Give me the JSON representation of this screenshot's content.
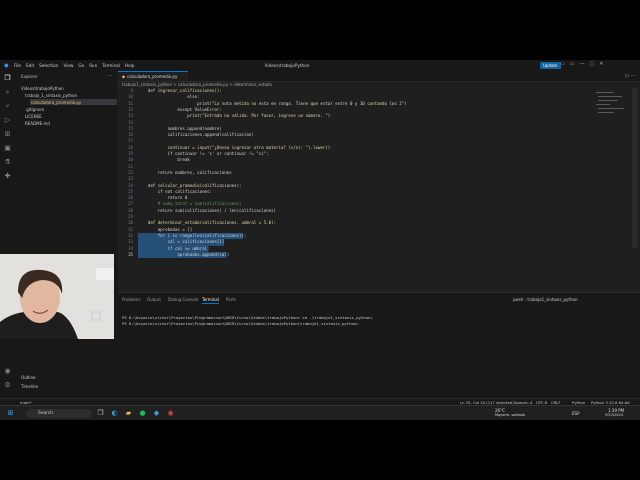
{
  "window": {
    "title": "Videos\\trabajoPython",
    "menu": [
      "File",
      "Edit",
      "Selection",
      "View",
      "Go",
      "Run",
      "Terminal",
      "Help"
    ],
    "update_label": "Update"
  },
  "sidebar": {
    "title": "Explorer",
    "root": "Videos\\trabajoPython",
    "items": [
      {
        "label": "trabajo_1_sintaxis_python"
      },
      {
        "label": "calculadora_promedio.py"
      },
      {
        "label": ".gitignore"
      },
      {
        "label": "LICENSE"
      },
      {
        "label": "README.md"
      }
    ],
    "outline": "Outline",
    "timeline": "Timeline"
  },
  "tab": {
    "label": "calculadora_promedio.py"
  },
  "breadcrumb": "trabajo1_sintaxis_python > calculadora_promedio.py > determinar_estado",
  "code": [
    {
      "n": "9",
      "text": "    def ingresar_calificaciones():"
    },
    {
      "n": "10",
      "text": "                    else:"
    },
    {
      "n": "11",
      "text": "                        print(\"La nota metida no esta en rango. Tiene que estar entre 0 y 10 contando los 2\")"
    },
    {
      "n": "12",
      "text": "                except ValueError:"
    },
    {
      "n": "13",
      "text": "                    print(\"Entrada no válida. Por favor, ingrese un número. \")"
    },
    {
      "n": "14",
      "text": ""
    },
    {
      "n": "15",
      "text": "            nombres.append(nombre)"
    },
    {
      "n": "16",
      "text": "            calificaciones.append(calificacion)"
    },
    {
      "n": "17",
      "text": ""
    },
    {
      "n": "18",
      "text": "            continuar = input(\"¿Desea ingresar otra materia? (s/n): \").lower()"
    },
    {
      "n": "19",
      "text": "            if continuar != 's' or continuar != \"si\":"
    },
    {
      "n": "20",
      "text": "                break"
    },
    {
      "n": "21",
      "text": ""
    },
    {
      "n": "22",
      "text": "        return nombres, calificaciones"
    },
    {
      "n": "23",
      "text": ""
    },
    {
      "n": "24",
      "text": "    def calcular_promedio(calificaciones):"
    },
    {
      "n": "25",
      "text": "        if not calificaciones:"
    },
    {
      "n": "26",
      "text": "            return 0"
    },
    {
      "n": "27",
      "text": "        # suma_total = sum(calificaciones)"
    },
    {
      "n": "28",
      "text": "        return sum(calificaciones) / len(calificaciones)"
    },
    {
      "n": "29",
      "text": ""
    },
    {
      "n": "30",
      "text": "    def determinar_estado(calificaciones, umbral = 5.0):"
    },
    {
      "n": "31",
      "text": "        aprobadas = []"
    },
    {
      "n": "32",
      "text": "        for i in range(len(calificaciones)):"
    },
    {
      "n": "33",
      "text": "            cal = calificaciones[i]"
    },
    {
      "n": "34",
      "text": "            if cal >= umbral:"
    },
    {
      "n": "35",
      "text": "                aprobadas.append(cal)"
    }
  ],
  "panel": {
    "tabs": [
      "Problems",
      "Output",
      "Debug Console",
      "Terminal",
      "Ports"
    ],
    "active_tab": "Terminal",
    "terminal_name": "pwsh - trabajo1_sintaxis_python",
    "lines": [
      "PS D:\\Usuario\\victor\\Proyectos\\Programacion\\UNIR\\Curso\\Videos\\trabajoPython> cd .\\trabajo1_sintaxis_python\\",
      "PS D:\\Usuario\\victor\\Proyectos\\Programacion\\UNIR\\Curso\\Videos\\trabajoPython\\trabajo1_sintaxis_python> "
    ]
  },
  "status": {
    "left": "main*",
    "position": "Ln 35, Col 34 (117 selected)",
    "spaces": "Spaces: 4",
    "encoding": "UTF-8",
    "eol": "CRLF",
    "language": "Python",
    "interpreter": "Python 3.12.6 64-bit"
  },
  "taskbar": {
    "search_label": "Search",
    "weather_temp": "26°C",
    "weather_text": "Mayorm. soleado",
    "lang": "ESP",
    "time": "1:39 PM",
    "date": "9/23/2024"
  },
  "colors": {
    "accent": "#0078d4",
    "selection": "#264f78",
    "keyword": "#c586c0",
    "function": "#dcdcaa",
    "string": "#ce9178"
  }
}
